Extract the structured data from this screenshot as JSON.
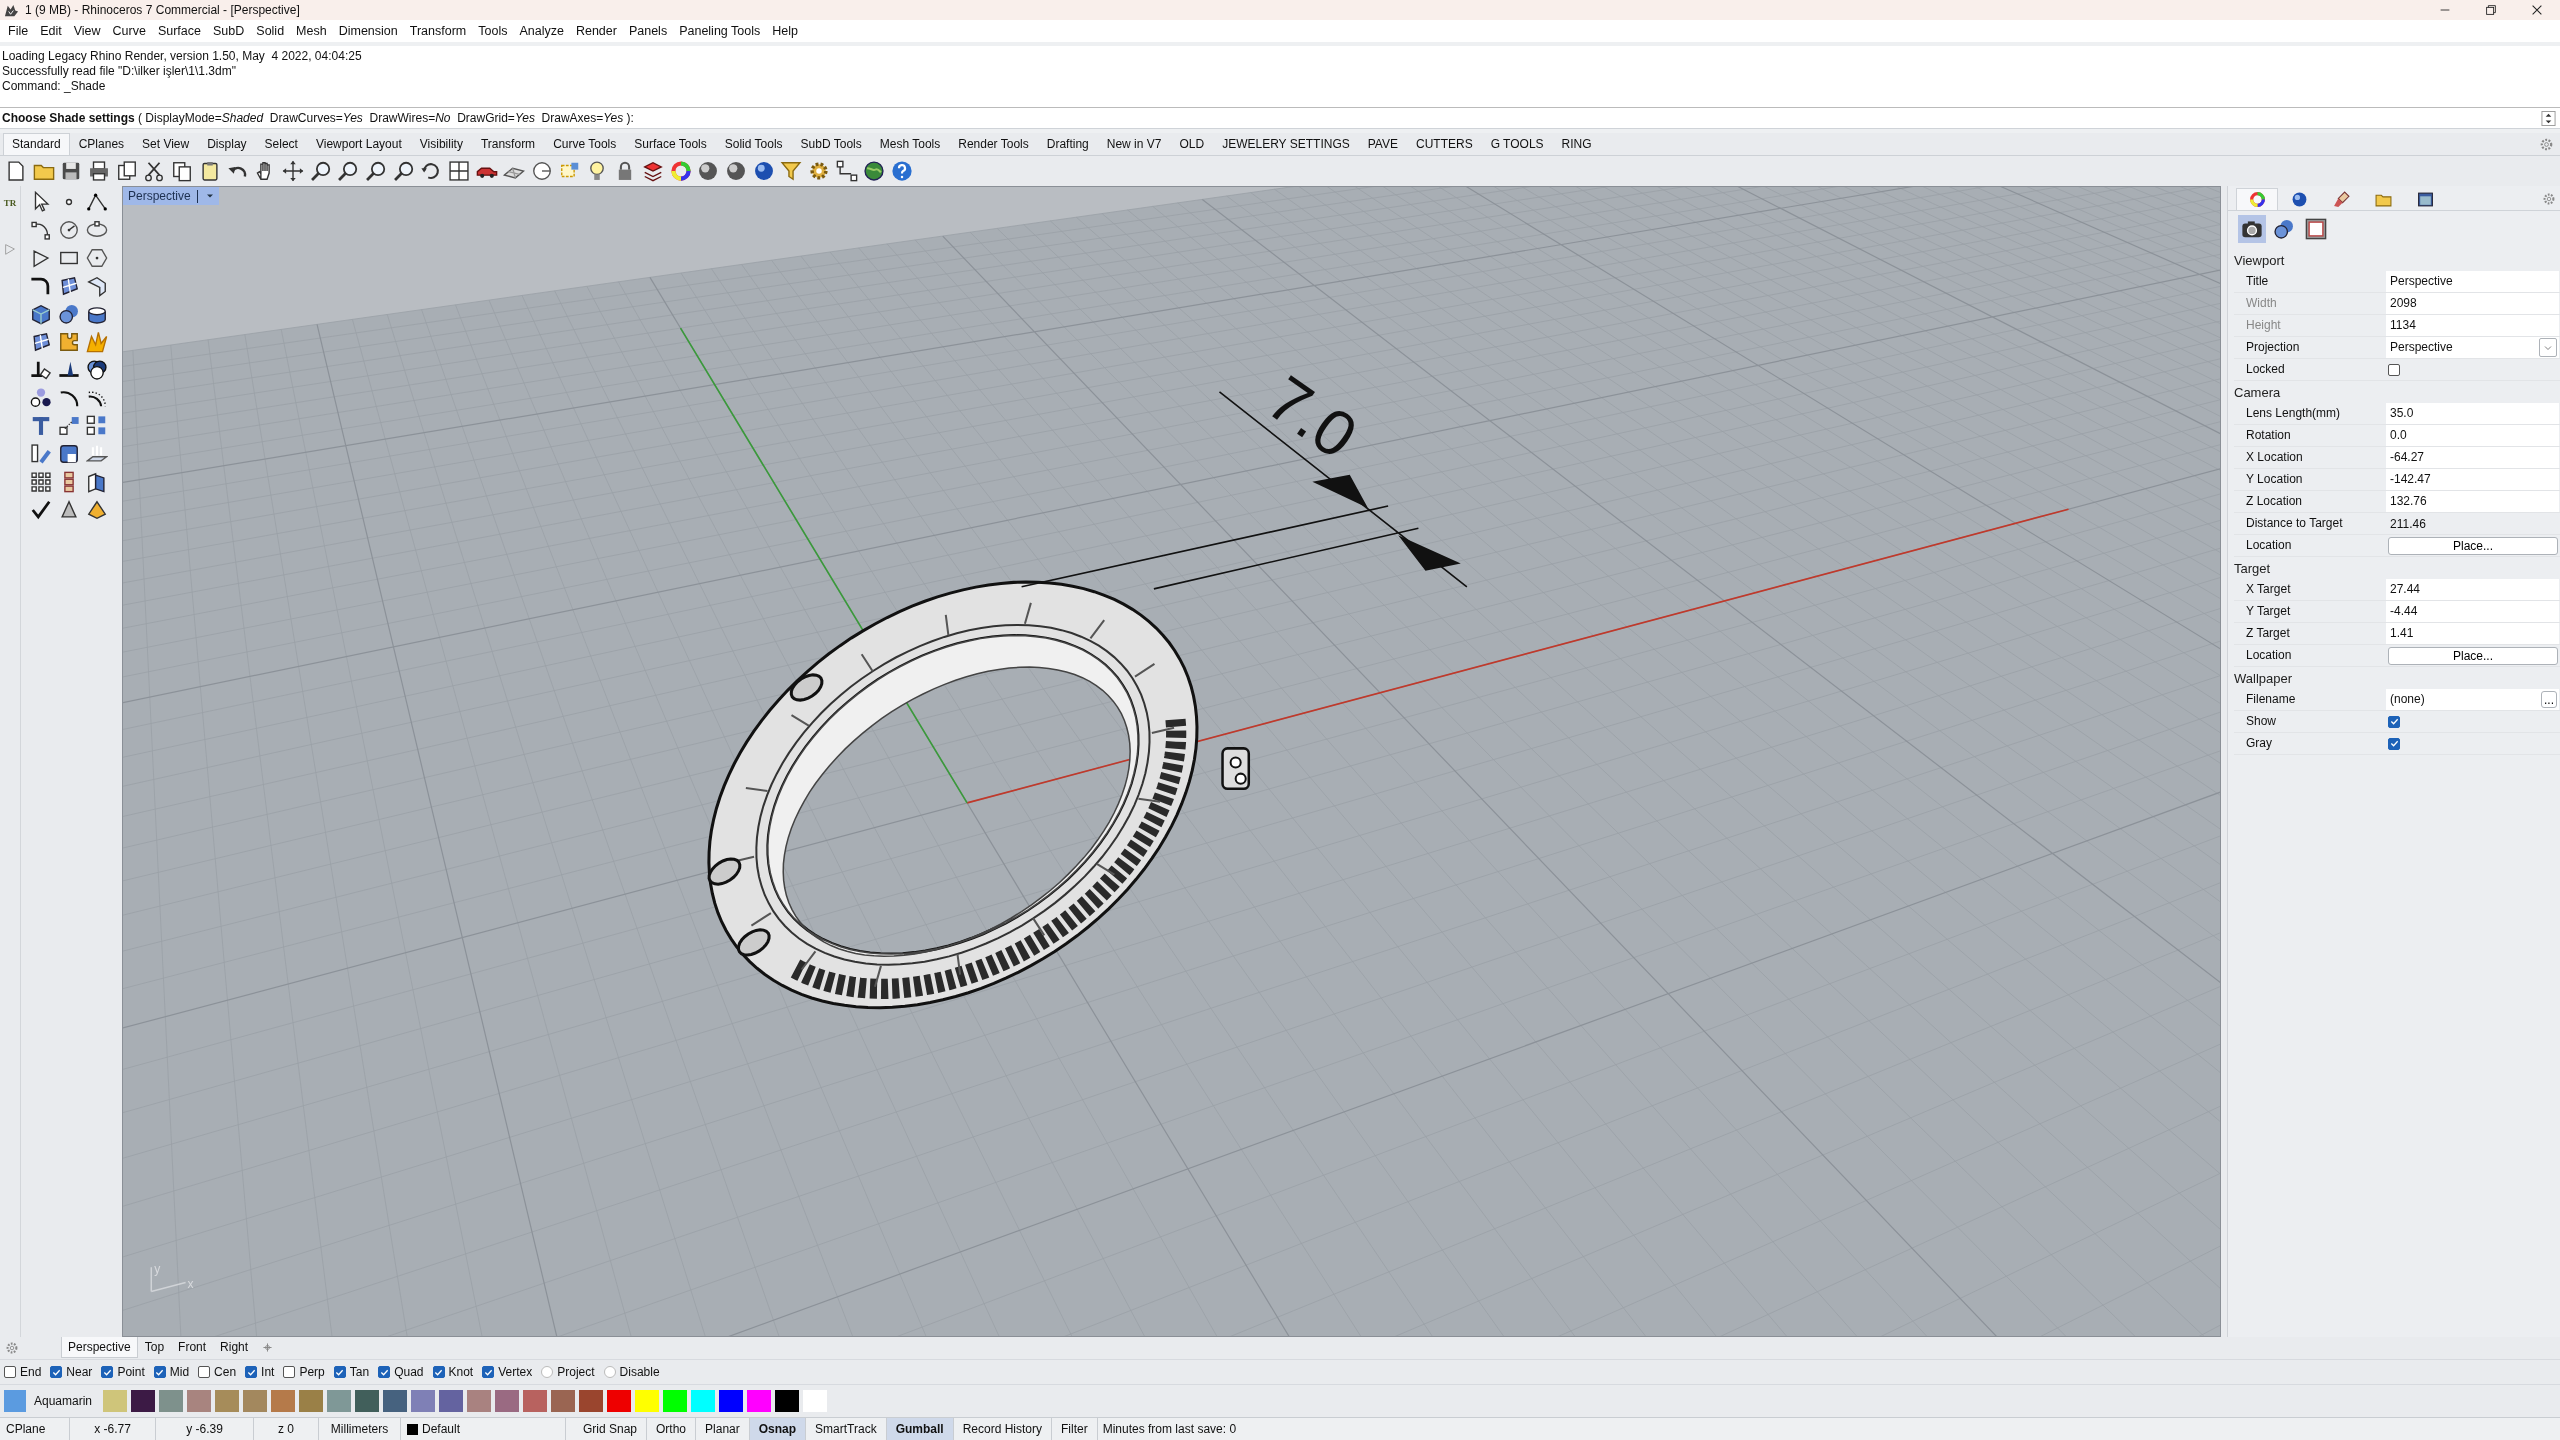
{
  "window": {
    "title": "1 (9 MB) - Rhinoceros 7 Commercial - [Perspective]"
  },
  "menu": [
    "File",
    "Edit",
    "View",
    "Curve",
    "Surface",
    "SubD",
    "Solid",
    "Mesh",
    "Dimension",
    "Transform",
    "Tools",
    "Analyze",
    "Render",
    "Panels",
    "Paneling Tools",
    "Help"
  ],
  "command_history": [
    "Loading Legacy Rhino Render, version 1.50, May  4 2022, 04:04:25",
    "Successfully read file \"D:\\ilker işler\\1\\1.3dm\"",
    "Command: _Shade"
  ],
  "command_prompt": "**Choose Shade settings** ( DisplayMode=*Shaded*  DrawCurves=*Yes*  DrawWires=*No*  DrawGrid=*Yes*  DrawAxes=*Yes* ):",
  "toolbar_tabs": [
    {
      "label": "Standard",
      "selected": true
    },
    {
      "label": "CPlanes",
      "selected": false
    },
    {
      "label": "Set View",
      "selected": false
    },
    {
      "label": "Display",
      "selected": false
    },
    {
      "label": "Select",
      "selected": false
    },
    {
      "label": "Viewport Layout",
      "selected": false
    },
    {
      "label": "Visibility",
      "selected": false
    },
    {
      "label": "Transform",
      "selected": false
    },
    {
      "label": "Curve Tools",
      "selected": false
    },
    {
      "label": "Surface Tools",
      "selected": false
    },
    {
      "label": "Solid Tools",
      "selected": false
    },
    {
      "label": "SubD Tools",
      "selected": false
    },
    {
      "label": "Mesh Tools",
      "selected": false
    },
    {
      "label": "Render Tools",
      "selected": false
    },
    {
      "label": "Drafting",
      "selected": false
    },
    {
      "label": "New in V7",
      "selected": false
    },
    {
      "label": "OLD",
      "selected": false
    },
    {
      "label": "JEWELERY SETTINGS",
      "selected": false
    },
    {
      "label": "PAVE",
      "selected": false
    },
    {
      "label": "CUTTERS",
      "selected": false
    },
    {
      "label": "G TOOLS",
      "selected": false
    },
    {
      "label": "RING",
      "selected": false
    }
  ],
  "left_toolbar": {
    "tab_label": "TR"
  },
  "viewport": {
    "title": "Perspective",
    "dimension_text": "7.0",
    "axis_labels": [
      "y",
      "x"
    ]
  },
  "properties": {
    "tabs": [
      {
        "selected": true
      },
      {
        "selected": false
      },
      {
        "selected": false
      },
      {
        "selected": false
      },
      {
        "selected": false
      }
    ],
    "subtabs": [
      {
        "selected": true
      },
      {
        "selected": false
      },
      {
        "selected": false
      }
    ],
    "sections": [
      {
        "title": "Viewport",
        "rows": [
          {
            "label": "Title",
            "kind": "text",
            "value": "Perspective",
            "disabled": false
          },
          {
            "label": "Width",
            "kind": "text",
            "value": "2098",
            "disabled": true
          },
          {
            "label": "Height",
            "kind": "text",
            "value": "1134",
            "disabled": true
          },
          {
            "label": "Projection",
            "kind": "dropdown",
            "value": "Perspective",
            "disabled": false
          },
          {
            "label": "Locked",
            "kind": "checkbox",
            "checked": false,
            "disabled": false
          }
        ]
      },
      {
        "title": "Camera",
        "rows": [
          {
            "label": "Lens Length(mm)",
            "kind": "text",
            "value": "35.0",
            "disabled": false
          },
          {
            "label": "Rotation",
            "kind": "text",
            "value": "0.0",
            "disabled": false
          },
          {
            "label": "X Location",
            "kind": "text",
            "value": "-64.27",
            "disabled": false
          },
          {
            "label": "Y Location",
            "kind": "text",
            "value": "-142.47",
            "disabled": false
          },
          {
            "label": "Z Location",
            "kind": "text",
            "value": "132.76",
            "disabled": false
          },
          {
            "label": "Distance to Target",
            "kind": "readonly",
            "value": "211.46",
            "disabled": false
          },
          {
            "label": "Location",
            "kind": "button",
            "value": "Place...",
            "disabled": false
          }
        ]
      },
      {
        "title": "Target",
        "rows": [
          {
            "label": "X Target",
            "kind": "text",
            "value": "27.44",
            "disabled": false
          },
          {
            "label": "Y Target",
            "kind": "text",
            "value": "-4.44",
            "disabled": false
          },
          {
            "label": "Z Target",
            "kind": "text",
            "value": "1.41",
            "disabled": false
          },
          {
            "label": "Location",
            "kind": "button",
            "value": "Place...",
            "disabled": false
          }
        ]
      },
      {
        "title": "Wallpaper",
        "rows": [
          {
            "label": "Filename",
            "kind": "file",
            "value": "(none)",
            "button": "...",
            "disabled": false
          },
          {
            "label": "Show",
            "kind": "checkbox",
            "checked": true,
            "disabled": false
          },
          {
            "label": "Gray",
            "kind": "checkbox",
            "checked": true,
            "disabled": false
          }
        ]
      }
    ]
  },
  "viewport_tabs": [
    {
      "label": "Perspective",
      "selected": true
    },
    {
      "label": "Top",
      "selected": false
    },
    {
      "label": "Front",
      "selected": false
    },
    {
      "label": "Right",
      "selected": false
    }
  ],
  "osnaps": [
    {
      "label": "End",
      "kind": "checkbox",
      "checked": false
    },
    {
      "label": "Near",
      "kind": "checkbox",
      "checked": true
    },
    {
      "label": "Point",
      "kind": "checkbox",
      "checked": true
    },
    {
      "label": "Mid",
      "kind": "checkbox",
      "checked": true
    },
    {
      "label": "Cen",
      "kind": "checkbox",
      "checked": false
    },
    {
      "label": "Int",
      "kind": "checkbox",
      "checked": true
    },
    {
      "label": "Perp",
      "kind": "checkbox",
      "checked": false
    },
    {
      "label": "Tan",
      "kind": "checkbox",
      "checked": true
    },
    {
      "label": "Quad",
      "kind": "checkbox",
      "checked": true
    },
    {
      "label": "Knot",
      "kind": "checkbox",
      "checked": true
    },
    {
      "label": "Vertex",
      "kind": "checkbox",
      "checked": true
    },
    {
      "label": "Project",
      "kind": "radio",
      "checked": false
    },
    {
      "label": "Disable",
      "kind": "radio",
      "checked": false
    }
  ],
  "layers": {
    "current": {
      "name": "Aquamarin",
      "color": "#5b9be0"
    },
    "swatches": [
      {
        "color": "#cfc57a"
      },
      {
        "color": "#3c1a45"
      },
      {
        "color": "#7e918c"
      },
      {
        "color": "#a8847f"
      },
      {
        "color": "#a68c5a"
      },
      {
        "color": "#a3885e"
      },
      {
        "color": "#b57a4a"
      },
      {
        "color": "#9a8047"
      },
      {
        "color": "#7f9897"
      },
      {
        "color": "#415f5b"
      },
      {
        "color": "#46627f"
      },
      {
        "color": "#7f80b6"
      },
      {
        "color": "#6463a0"
      },
      {
        "color": "#a98280"
      },
      {
        "color": "#9a6a82"
      },
      {
        "color": "#b8625f"
      },
      {
        "color": "#9a6552"
      },
      {
        "color": "#9a452e"
      },
      {
        "color": "#ee0000"
      },
      {
        "color": "#ffff00"
      },
      {
        "color": "#00ff00"
      },
      {
        "color": "#00ffff"
      },
      {
        "color": "#0000ff"
      },
      {
        "color": "#ff00ff"
      },
      {
        "color": "#000000"
      },
      {
        "color": "#ffffff"
      }
    ]
  },
  "status_bar": {
    "cplane": "CPlane",
    "x": "x -6.77",
    "y": "y -6.39",
    "z": "z 0",
    "units": "Millimeters",
    "layer": {
      "name": "Default",
      "color": "#000000"
    },
    "toggles": [
      {
        "label": "Grid Snap",
        "on": false
      },
      {
        "label": "Ortho",
        "on": false
      },
      {
        "label": "Planar",
        "on": false
      },
      {
        "label": "Osnap",
        "on": true
      },
      {
        "label": "SmartTrack",
        "on": false
      },
      {
        "label": "Gumball",
        "on": true
      },
      {
        "label": "Record History",
        "on": false
      },
      {
        "label": "Filter",
        "on": false
      }
    ],
    "message": "Minutes from last save: 0"
  }
}
